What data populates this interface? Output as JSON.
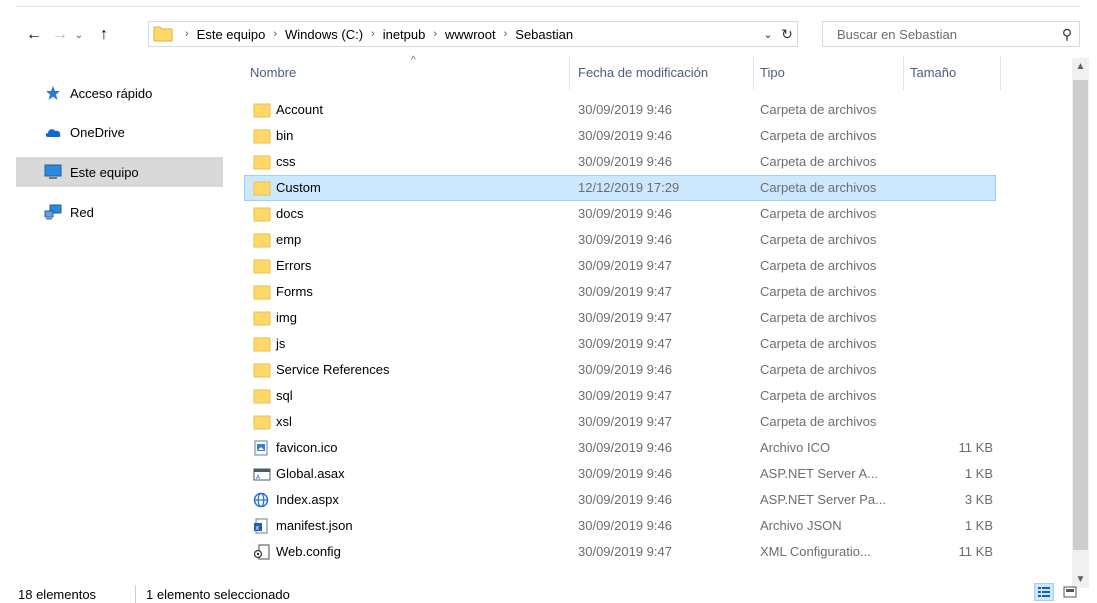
{
  "nav": {
    "back_icon": "arrow-left-icon",
    "forward_icon": "arrow-right-icon",
    "recent_icon": "chevron-down-icon",
    "up_icon": "arrow-up-icon",
    "breadcrumbs": [
      "Este equipo",
      "Windows (C:)",
      "inetpub",
      "wwwroot",
      "Sebastian"
    ],
    "search_placeholder": "Buscar en Sebastian"
  },
  "sidebar": {
    "items": [
      {
        "label": "Acceso rápido",
        "icon": "star-icon",
        "selected": false
      },
      {
        "label": "OneDrive",
        "icon": "cloud-icon",
        "selected": false
      },
      {
        "label": "Este equipo",
        "icon": "computer-icon",
        "selected": true
      },
      {
        "label": "Red",
        "icon": "network-icon",
        "selected": false
      }
    ]
  },
  "columns": {
    "name": "Nombre",
    "date": "Fecha de modificación",
    "type": "Tipo",
    "size": "Tamaño"
  },
  "files": [
    {
      "name": "Account",
      "date": "30/09/2019 9:46",
      "type": "Carpeta de archivos",
      "size": "",
      "icon": "folder-icon"
    },
    {
      "name": "bin",
      "date": "30/09/2019 9:46",
      "type": "Carpeta de archivos",
      "size": "",
      "icon": "folder-icon"
    },
    {
      "name": "css",
      "date": "30/09/2019 9:46",
      "type": "Carpeta de archivos",
      "size": "",
      "icon": "folder-icon"
    },
    {
      "name": "Custom",
      "date": "12/12/2019 17:29",
      "type": "Carpeta de archivos",
      "size": "",
      "icon": "folder-icon",
      "selected": true
    },
    {
      "name": "docs",
      "date": "30/09/2019 9:46",
      "type": "Carpeta de archivos",
      "size": "",
      "icon": "folder-icon"
    },
    {
      "name": "emp",
      "date": "30/09/2019 9:46",
      "type": "Carpeta de archivos",
      "size": "",
      "icon": "folder-icon"
    },
    {
      "name": "Errors",
      "date": "30/09/2019 9:47",
      "type": "Carpeta de archivos",
      "size": "",
      "icon": "folder-icon"
    },
    {
      "name": "Forms",
      "date": "30/09/2019 9:47",
      "type": "Carpeta de archivos",
      "size": "",
      "icon": "folder-icon"
    },
    {
      "name": "img",
      "date": "30/09/2019 9:47",
      "type": "Carpeta de archivos",
      "size": "",
      "icon": "folder-icon"
    },
    {
      "name": "js",
      "date": "30/09/2019 9:47",
      "type": "Carpeta de archivos",
      "size": "",
      "icon": "folder-icon"
    },
    {
      "name": "Service References",
      "date": "30/09/2019 9:46",
      "type": "Carpeta de archivos",
      "size": "",
      "icon": "folder-icon"
    },
    {
      "name": "sql",
      "date": "30/09/2019 9:47",
      "type": "Carpeta de archivos",
      "size": "",
      "icon": "folder-icon"
    },
    {
      "name": "xsl",
      "date": "30/09/2019 9:47",
      "type": "Carpeta de archivos",
      "size": "",
      "icon": "folder-icon"
    },
    {
      "name": "favicon.ico",
      "date": "30/09/2019 9:46",
      "type": "Archivo ICO",
      "size": "11 KB",
      "icon": "image-file-icon"
    },
    {
      "name": "Global.asax",
      "date": "30/09/2019 9:46",
      "type": "ASP.NET Server A...",
      "size": "1 KB",
      "icon": "asax-file-icon"
    },
    {
      "name": "Index.aspx",
      "date": "30/09/2019 9:46",
      "type": "ASP.NET Server Pa...",
      "size": "3 KB",
      "icon": "web-globe-icon"
    },
    {
      "name": "manifest.json",
      "date": "30/09/2019 9:46",
      "type": "Archivo JSON",
      "size": "1 KB",
      "icon": "json-file-icon"
    },
    {
      "name": "Web.config",
      "date": "30/09/2019 9:47",
      "type": "XML Configuratio...",
      "size": "11 KB",
      "icon": "config-file-icon"
    }
  ],
  "status": {
    "count": "18 elementos",
    "selection": "1 elemento seleccionado"
  },
  "colors": {
    "selection_bg": "#cce8ff",
    "selection_border": "#99d1ff",
    "folder": "#ffd867",
    "header_text": "#4c607a"
  }
}
